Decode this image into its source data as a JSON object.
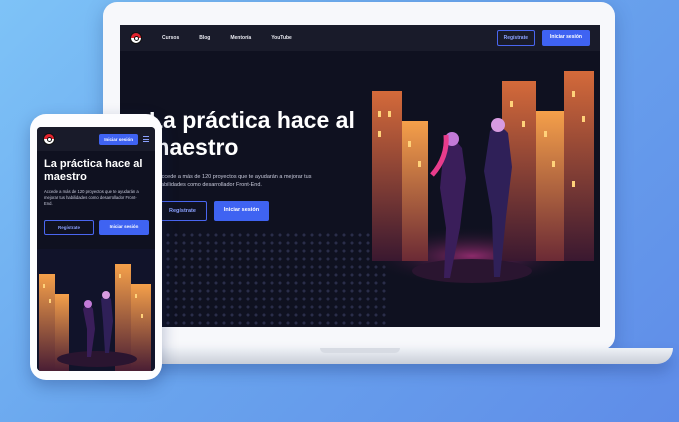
{
  "site": {
    "nav_links": [
      "Cursos",
      "Blog",
      "Mentoría",
      "YouTube"
    ],
    "register_label": "Regístrate",
    "login_label": "Iniciar sesión"
  },
  "laptop": {
    "hero_title": "La práctica hace al maestro",
    "hero_description": "Accede a más de 120 proyectos que te ayudarán a mejorar tus habilidades como desarrollador Front-End.",
    "register_label": "Regístrate",
    "login_label": "Iniciar sesión"
  },
  "phone": {
    "login_label": "Iniciar sesión",
    "hero_title": "La práctica hace al maestro",
    "hero_description": "Accede a más de 120 proyectos que te ayudarán a mejorar tus habilidades como desarrollador Front-End.",
    "register_label": "Regístrate",
    "login_button_label": "Iniciar sesión"
  },
  "icons": [
    "pokeball-logo-icon",
    "hamburger-menu-icon"
  ],
  "colors": {
    "background_start": "#7ec3f7",
    "background_end": "#5f8ce8",
    "screen_bg": "#0f1120",
    "nav_bg": "#191b2a",
    "accent_blue": "#3f63f2",
    "building_orange": "#f07a2a",
    "neon_pink": "#e83c8c"
  }
}
